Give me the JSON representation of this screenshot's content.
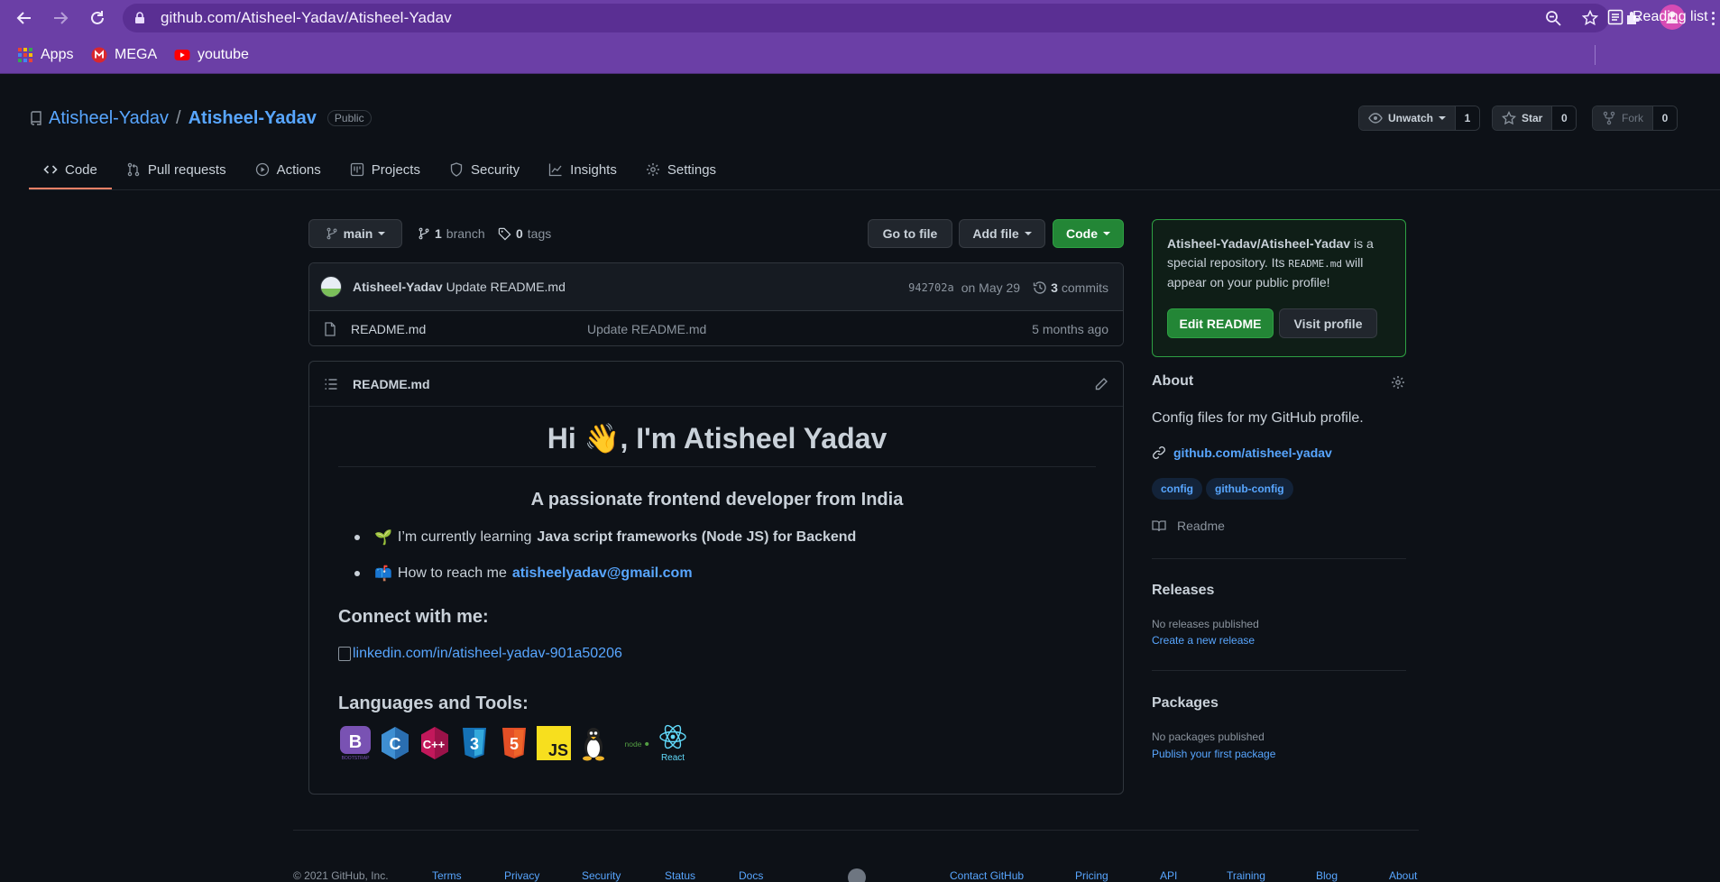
{
  "browser": {
    "url": "github.com/Atisheel-Yadav/Atisheel-Yadav",
    "bookmarks": [
      {
        "label": "Apps",
        "icon": "apps-grid-icon"
      },
      {
        "label": "MEGA",
        "icon": "mega-icon"
      },
      {
        "label": "youtube",
        "icon": "youtube-icon"
      }
    ],
    "reading_list": "Reading list"
  },
  "repo": {
    "owner": "Atisheel-Yadav",
    "separator": "/",
    "name": "Atisheel-Yadav",
    "visibility": "Public",
    "unwatch_label": "Unwatch",
    "watch_count": "1",
    "star_label": "Star",
    "star_count": "0",
    "fork_label": "Fork",
    "fork_count": "0"
  },
  "tabs": [
    {
      "label": "Code",
      "icon": "code-icon",
      "active": true
    },
    {
      "label": "Pull requests",
      "icon": "pull-request-icon"
    },
    {
      "label": "Actions",
      "icon": "play-icon"
    },
    {
      "label": "Projects",
      "icon": "project-icon"
    },
    {
      "label": "Security",
      "icon": "shield-icon"
    },
    {
      "label": "Insights",
      "icon": "graph-icon"
    },
    {
      "label": "Settings",
      "icon": "gear-icon"
    }
  ],
  "toolbar": {
    "branch": "main",
    "branch_count": "1",
    "branch_label": "branch",
    "tag_count": "0",
    "tag_label": "tags",
    "go_to_file": "Go to file",
    "add_file": "Add file",
    "code": "Code"
  },
  "commit": {
    "author": "Atisheel-Yadav",
    "message": "Update README.md",
    "sha": "942702a",
    "date": "on May 29",
    "count": "3",
    "count_label": "commits"
  },
  "files": [
    {
      "name": "README.md",
      "message": "Update README.md",
      "time": "5 months ago"
    }
  ],
  "readme": {
    "file_title": "README.md",
    "heading_before": "Hi",
    "heading_emoji": "👋",
    "heading_after": ", I'm Atisheel Yadav",
    "subheading": "A passionate frontend developer from India",
    "item1_emoji": "🌱",
    "item1_text": "I’m currently learning",
    "item1_bold": "Java script frameworks (Node JS) for Backend",
    "item2_emoji": "📫",
    "item2_text": "How to reach me",
    "item2_link": "atisheelyadav@gmail.com",
    "connect_heading": "Connect with me:",
    "linkedin_alt": "linkedin.com/in/atisheel-yadav-901a50206",
    "tools_heading": "Languages and Tools:",
    "tools": [
      {
        "name": "bootstrap",
        "label": "BOOTSTRAP",
        "color": "#7952b3"
      },
      {
        "name": "c",
        "label": "C",
        "color": "#3f8fd2"
      },
      {
        "name": "cplusplus",
        "label": "C++",
        "color": "#c2185b"
      },
      {
        "name": "css3",
        "label": "3",
        "color": "#1572b6"
      },
      {
        "name": "html5",
        "label": "5",
        "color": "#e34f26"
      },
      {
        "name": "javascript",
        "label": "JS",
        "color": "#f7df1e"
      },
      {
        "name": "linux",
        "label": "",
        "color": "#ffffff"
      },
      {
        "name": "nodejs",
        "label": "node",
        "color": "#539e43"
      },
      {
        "name": "react",
        "label": "React",
        "color": "#61dafb"
      }
    ]
  },
  "sidebar": {
    "special_repo_name": "Atisheel-Yadav/Atisheel-Yadav",
    "special_text_1": "is a special repository. Its",
    "special_code": "README.md",
    "special_text_2": "will appear on your public profile!",
    "edit_readme": "Edit README",
    "visit_profile": "Visit profile",
    "about_heading": "About",
    "about_description": "Config files for my GitHub profile.",
    "website": "github.com/atisheel-yadav",
    "topics": [
      "config",
      "github-config"
    ],
    "readme_label": "Readme",
    "releases_heading": "Releases",
    "no_releases": "No releases published",
    "create_release": "Create a new release",
    "packages_heading": "Packages",
    "no_packages": "No packages published",
    "publish_package": "Publish your first package"
  },
  "footer": {
    "copyright": "© 2021 GitHub, Inc.",
    "left_links": [
      "Terms",
      "Privacy",
      "Security",
      "Status",
      "Docs"
    ],
    "right_links": [
      "Contact GitHub",
      "Pricing",
      "API",
      "Training",
      "Blog",
      "About"
    ]
  },
  "colors": {
    "accent_blue": "#58a6ff",
    "green": "#238636",
    "tab_underline": "#f78166",
    "chrome_purple": "#6b3fa6"
  }
}
